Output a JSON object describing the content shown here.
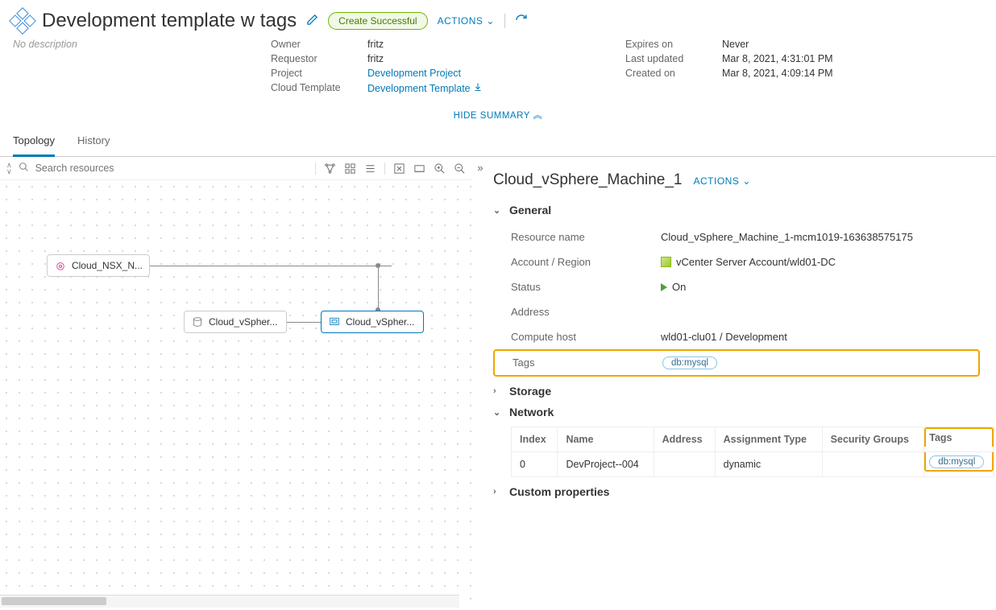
{
  "header": {
    "title": "Development template w tags",
    "status": "Create Successful",
    "actions_label": "ACTIONS",
    "description": "No description"
  },
  "summary": {
    "owner_lbl": "Owner",
    "owner_val": "fritz",
    "requestor_lbl": "Requestor",
    "requestor_val": "fritz",
    "project_lbl": "Project",
    "project_val": "Development Project",
    "template_lbl": "Cloud Template",
    "template_val": "Development Template",
    "expires_lbl": "Expires on",
    "expires_val": "Never",
    "updated_lbl": "Last updated",
    "updated_val": "Mar 8, 2021, 4:31:01 PM",
    "created_lbl": "Created on",
    "created_val": "Mar 8, 2021, 4:09:14 PM"
  },
  "hide_summary": "HIDE SUMMARY",
  "tabs": {
    "topology": "Topology",
    "history": "History"
  },
  "search": {
    "placeholder": "Search resources"
  },
  "canvas": {
    "node_nsx": "Cloud_NSX_N...",
    "node_disk": "Cloud_vSpher...",
    "node_vm": "Cloud_vSpher..."
  },
  "details": {
    "title": "Cloud_vSphere_Machine_1",
    "actions_label": "ACTIONS",
    "sections": {
      "general": "General",
      "storage": "Storage",
      "network": "Network",
      "custom": "Custom properties"
    },
    "general": {
      "resource_name_lbl": "Resource name",
      "resource_name_val": "Cloud_vSphere_Machine_1-mcm1019-163638575175",
      "account_lbl": "Account / Region",
      "account_val": "vCenter Server Account/wld01-DC",
      "status_lbl": "Status",
      "status_val": "On",
      "address_lbl": "Address",
      "address_val": "",
      "host_lbl": "Compute host",
      "host_val": "wld01-clu01 / Development",
      "tags_lbl": "Tags",
      "tag_value": "db:mysql"
    },
    "network": {
      "headers": {
        "index": "Index",
        "name": "Name",
        "address": "Address",
        "assignment": "Assignment Type",
        "security": "Security Groups",
        "tags": "Tags"
      },
      "row": {
        "index": "0",
        "name": "DevProject--004",
        "address": "",
        "assignment": "dynamic",
        "security": "",
        "tag": "db:mysql"
      }
    }
  }
}
